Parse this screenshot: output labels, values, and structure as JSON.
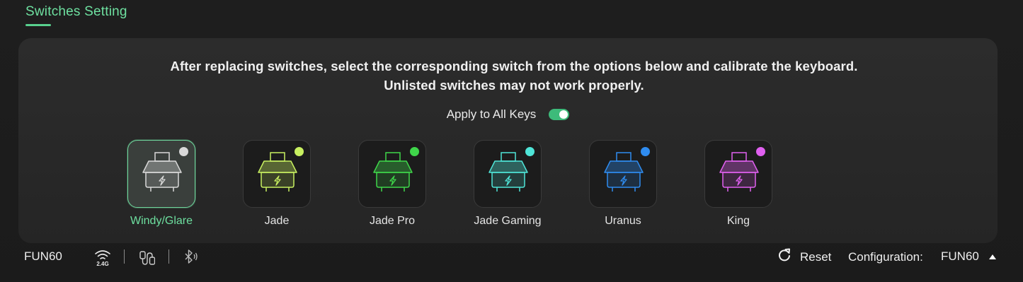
{
  "section": {
    "title": "Switches Setting"
  },
  "panel": {
    "instruction": "After replacing switches, select the corresponding switch from the options below and calibrate the keyboard. Unlisted switches may not work properly.",
    "apply_all": {
      "label": "Apply to All Keys",
      "enabled": true
    }
  },
  "switches": [
    {
      "name": "Windy/Glare",
      "color": "#d9d9d9",
      "selected": true
    },
    {
      "name": "Jade",
      "color": "#c8f060",
      "selected": false
    },
    {
      "name": "Jade Pro",
      "color": "#3fd64a",
      "selected": false
    },
    {
      "name": "Jade Gaming",
      "color": "#4fe5d8",
      "selected": false
    },
    {
      "name": "Uranus",
      "color": "#2f8cf0",
      "selected": false
    },
    {
      "name": "King",
      "color": "#e060f0",
      "selected": false
    }
  ],
  "footer": {
    "device_name": "FUN60",
    "connection_icons": [
      "wireless-2.4g-icon",
      "usb-cable-icon",
      "bluetooth-icon"
    ],
    "wireless_label": "2.4G",
    "reset_label": "Reset",
    "config_label": "Configuration:",
    "config_value": "FUN60"
  },
  "colors": {
    "accent": "#6ee0a0",
    "panel_bg": "#2a2a2a",
    "page_bg": "#1c1c1c"
  }
}
